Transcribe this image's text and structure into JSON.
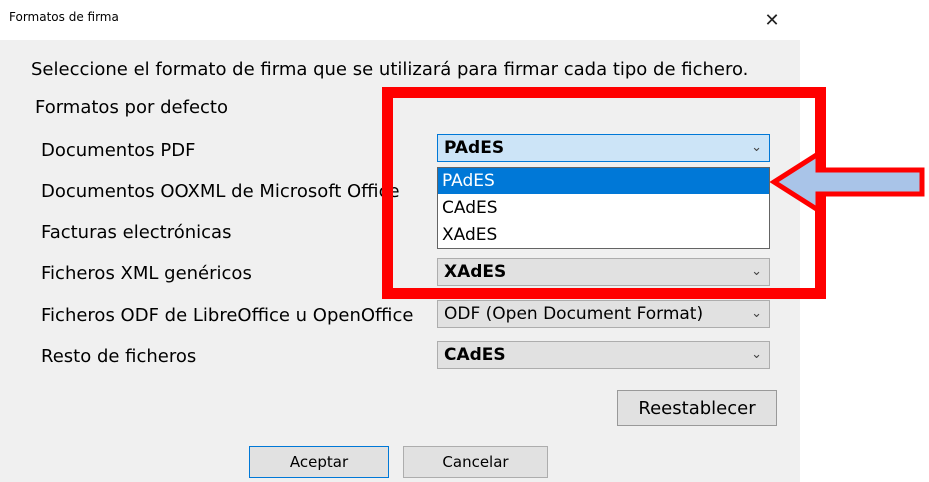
{
  "window": {
    "title": "Formatos de firma",
    "close_glyph": "✕"
  },
  "intro_text": "Seleccione el formato de firma que se utilizará para firmar cada tipo de fichero.",
  "group_title": "Formatos por defecto",
  "rows": [
    {
      "label": "Documentos PDF",
      "value": "PAdES"
    },
    {
      "label": "Documentos OOXML de Microsoft Office",
      "value": ""
    },
    {
      "label": "Facturas electrónicas",
      "value": ""
    },
    {
      "label": "Ficheros XML genéricos",
      "value": "XAdES"
    },
    {
      "label": "Ficheros ODF de LibreOffice u OpenOffice",
      "value": "ODF (Open Document Format)"
    },
    {
      "label": "Resto de ficheros",
      "value": "CAdES"
    }
  ],
  "dropdown": {
    "options": [
      "PAdES",
      "CAdES",
      "XAdES"
    ],
    "selected_index": 0
  },
  "buttons": {
    "reset": "Reestablecer",
    "accept": "Aceptar",
    "cancel": "Cancelar"
  },
  "annotation": {
    "box_color": "#ff0000",
    "arrow_fill": "#a9c4e8",
    "arrow_stroke": "#ff0000"
  }
}
